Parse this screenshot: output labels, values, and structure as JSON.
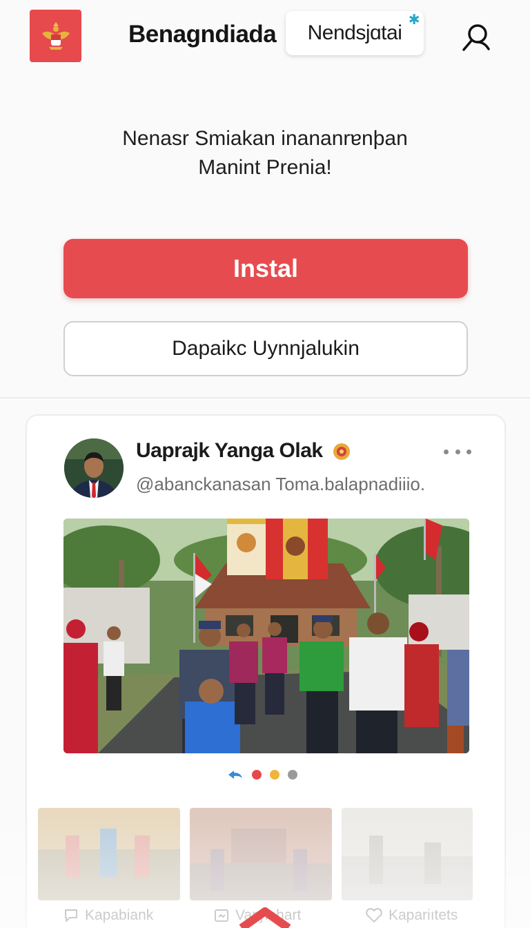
{
  "header": {
    "title": "Benagndiada",
    "chip_label": "Nendsjɑtai",
    "logo_icon": "garuda-emblem-icon",
    "search_icon": "search-icon"
  },
  "hero": {
    "line1": "Nenasr Smiakan inananrɐnþan",
    "line2": "Manint Prenia!",
    "install_label": "Instal",
    "secondary_label": "Dapaikc Uynnjalukin"
  },
  "post": {
    "author_name": "Uaprajk Yanga Olak",
    "author_handle": "@abanckanasan Toma.balapnadiiio.",
    "more_icon": "more-options-icon",
    "image_icon": "photo-ceremony",
    "carousel_dots": [
      "#3a8ad6",
      "#e6494c",
      "#f0b43a",
      "#9a9a9a"
    ]
  },
  "actions": [
    {
      "label": "Kapabiank",
      "icon": "comment-icon"
    },
    {
      "label": "Vaɲɲahart",
      "icon": "share-icon"
    },
    {
      "label": "Kapariıtets",
      "icon": "heart-icon"
    }
  ],
  "colors": {
    "accent": "#e64c4f",
    "background": "#fafafa"
  }
}
